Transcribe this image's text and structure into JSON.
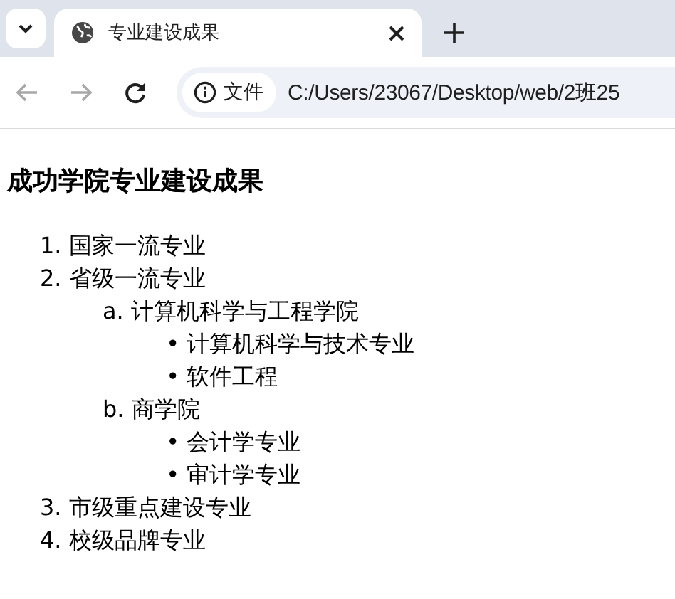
{
  "tab_bar": {
    "tabs": [
      {
        "title": "专业建设成果",
        "selected": true
      }
    ]
  },
  "toolbar": {
    "back": {
      "disabled": true
    },
    "forward": {
      "disabled": true
    },
    "address": {
      "chip": "文件",
      "url": "C:/Users/23067/Desktop/web/2班25"
    }
  },
  "page": {
    "heading": "成功学院专业建设成果",
    "items": [
      {
        "marker": "1.",
        "text": "国家一流专业"
      },
      {
        "marker": "2.",
        "text": "省级一流专业",
        "children": [
          {
            "marker": "a.",
            "text": "计算机科学与工程学院",
            "children": [
              {
                "marker": "•",
                "text": "计算机科学与技术专业"
              },
              {
                "marker": "•",
                "text": "软件工程"
              }
            ]
          },
          {
            "marker": "b.",
            "text": "商学院",
            "children": [
              {
                "marker": "•",
                "text": "会计学专业"
              },
              {
                "marker": "•",
                "text": "审计学专业"
              }
            ]
          }
        ]
      },
      {
        "marker": "3.",
        "text": "市级重点建设专业"
      },
      {
        "marker": "4.",
        "text": "校级品牌专业"
      }
    ]
  }
}
